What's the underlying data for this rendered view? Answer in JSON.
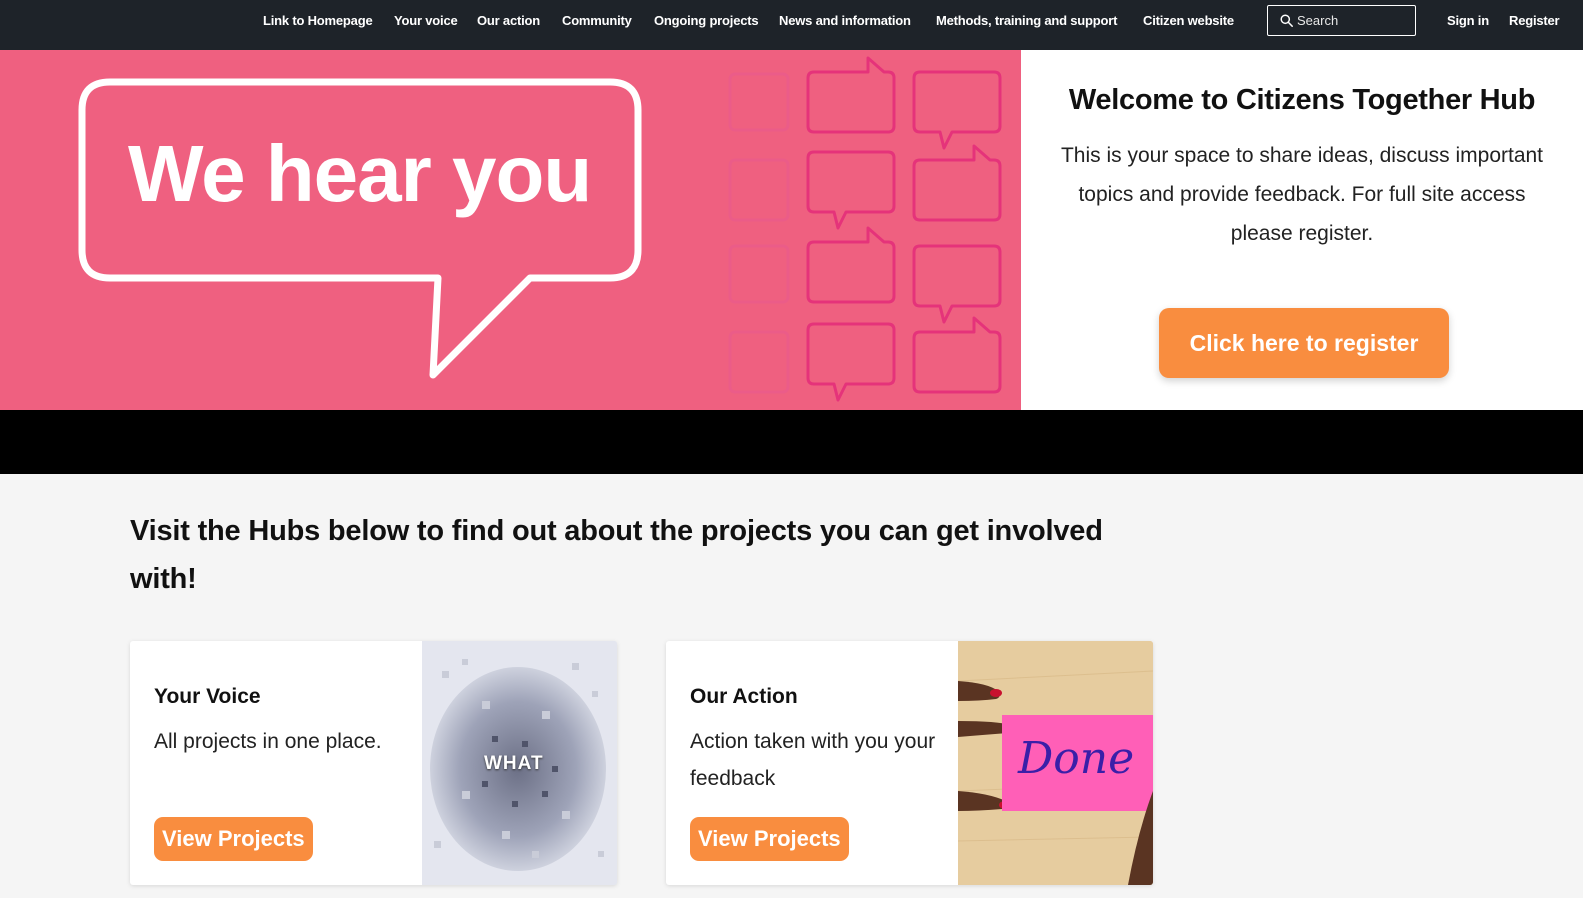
{
  "nav": {
    "links": [
      "Link to Homepage",
      "Your voice",
      "Our action",
      "Community",
      "Ongoing projects",
      "News and information",
      "Methods, training and support",
      "Citizen website"
    ],
    "search_placeholder": "Search",
    "sign_in": "Sign in",
    "register": "Register"
  },
  "hero": {
    "banner_text": "We hear you",
    "welcome_title": "Welcome to Citizens Together Hub",
    "welcome_text": "This is your space to share ideas, discuss important topics and provide feedback. For full site access please register.",
    "register_button": "Click here to register"
  },
  "hubs": {
    "heading": "Visit the Hubs below to find out about the projects you can get involved with!",
    "cards": [
      {
        "title": "Your Voice",
        "description": "All projects in one place.",
        "button": "View Projects",
        "image_text": "WHAT"
      },
      {
        "title": "Our Action",
        "description": "Action taken with you your feedback",
        "button": "View Projects",
        "image_text": "Done"
      }
    ]
  },
  "colors": {
    "nav_bg": "#1e2329",
    "hero_pink": "#ef6080",
    "accent_orange": "#f98d3f",
    "outline_pink": "#e5337a"
  }
}
